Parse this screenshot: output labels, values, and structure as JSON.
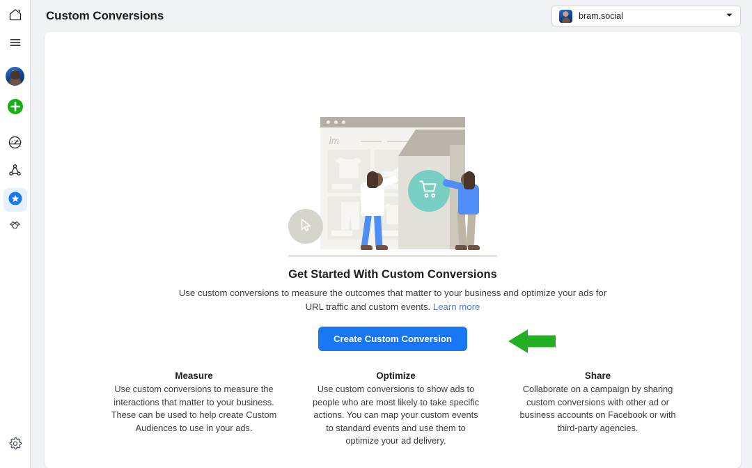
{
  "sidebar": {
    "items": [
      {
        "name": "home",
        "icon": "home-icon",
        "active": false
      },
      {
        "name": "menu",
        "icon": "hamburger-menu-icon",
        "active": false
      },
      {
        "name": "profile",
        "icon": "user-avatar",
        "active": false
      },
      {
        "name": "create",
        "icon": "plus-circle-icon",
        "active": false
      },
      {
        "name": "performance",
        "icon": "speedometer-icon",
        "active": false
      },
      {
        "name": "network",
        "icon": "network-graph-icon",
        "active": false
      },
      {
        "name": "custom-conversions",
        "icon": "star-circle-icon",
        "active": true
      },
      {
        "name": "partnerships",
        "icon": "handshake-icon",
        "active": false
      }
    ],
    "settings_icon": "gear-icon"
  },
  "header": {
    "title": "Custom Conversions",
    "account": {
      "name": "bram.social",
      "avatar": "account-avatar",
      "chevron": "chevron-down-icon"
    }
  },
  "hero": {
    "illustration": "storefront-shopping-illustration",
    "title": "Get Started With Custom Conversions",
    "description": "Use custom conversions to measure the outcomes that matter to your business and optimize your ads for URL traffic and custom events.",
    "learn_more": "Learn more",
    "cta_label": "Create Custom Conversion",
    "annotation_arrow": "green-left-arrow"
  },
  "features": [
    {
      "heading": "Measure",
      "body": "Use custom conversions to measure the interactions that matter to your business. These can be used to help create Custom Audiences to use in your ads."
    },
    {
      "heading": "Optimize",
      "body": "Use custom conversions to show ads to people who are most likely to take specific actions. You can map your custom events to standard events and use them to optimize your ad delivery."
    },
    {
      "heading": "Share",
      "body": "Collaborate on a campaign by sharing custom conversions with other ad or business accounts on Facebook or with third-party agencies."
    }
  ],
  "colors": {
    "primary_blue": "#1877f2",
    "link_blue": "#4a7fc1",
    "annotation_green": "#22b022",
    "accent_teal": "#79cec3",
    "page_bg": "#f0f2f5"
  }
}
